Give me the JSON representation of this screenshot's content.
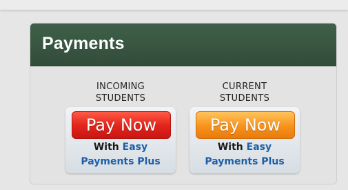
{
  "panel": {
    "title": "Payments"
  },
  "groups": [
    {
      "label_line1": "INCOMING",
      "label_line2": "STUDENTS",
      "button_label": "Pay Now",
      "with_text": "With",
      "brand_word": "Easy",
      "brand_line2": "Payments Plus",
      "button_color": "#e3261c"
    },
    {
      "label_line1": "CURRENT",
      "label_line2": "STUDENTS",
      "button_label": "Pay Now",
      "with_text": "With",
      "brand_word": "Easy",
      "brand_line2": "Payments Plus",
      "button_color": "#f7921c"
    }
  ],
  "colors": {
    "header_bg": "#3f6048",
    "brand_blue": "#1c5fa6",
    "page_bg": "#e6e6e6"
  }
}
